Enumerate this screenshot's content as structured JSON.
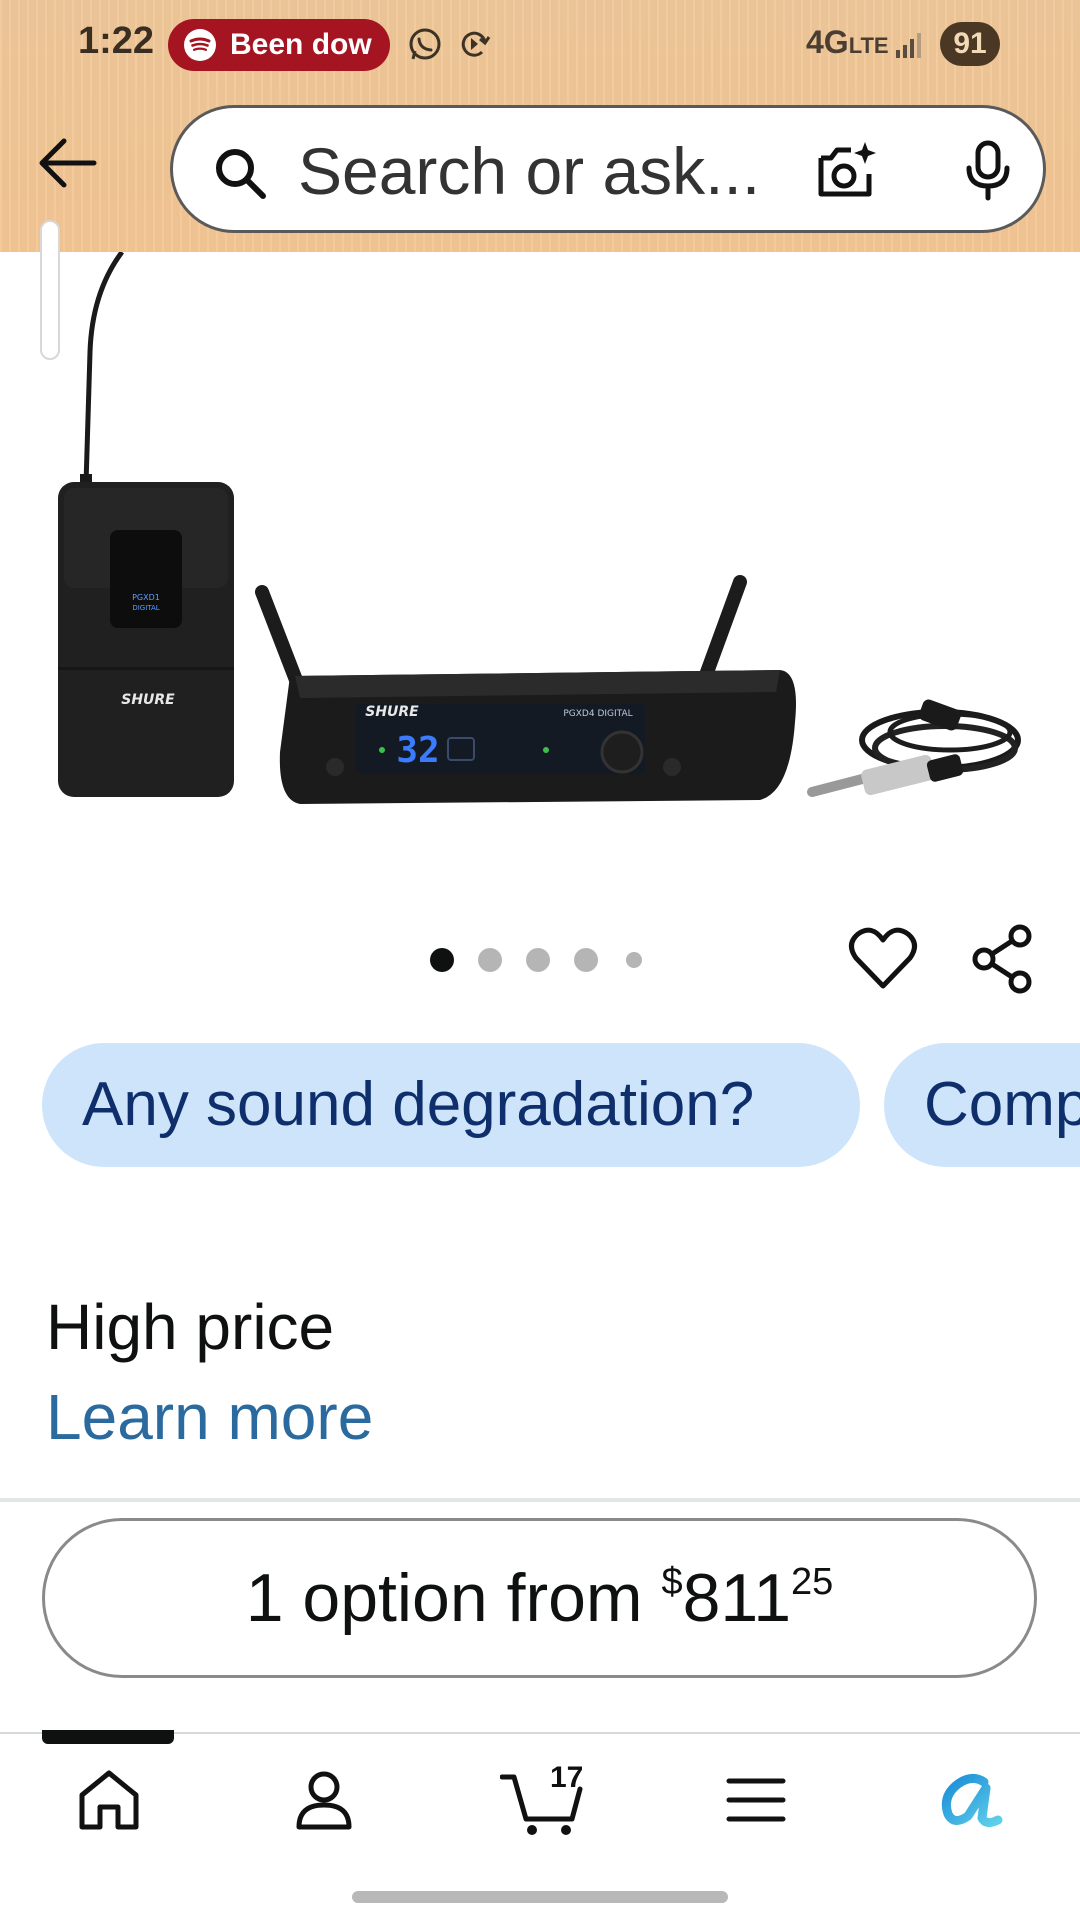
{
  "status_bar": {
    "time": "1:22",
    "notification_text": "Been dow",
    "network": "4G",
    "network_sub": "LTE",
    "battery": "91"
  },
  "search": {
    "placeholder": "Search or ask..."
  },
  "product": {
    "image_alt": "Shure PGXD14 digital wireless guitar system",
    "brand_on_image": "SHURE",
    "model_on_image": "PGXD4 DIGITAL",
    "display_on_image": "32"
  },
  "carousel": {
    "image_count": 5,
    "active_index": 0
  },
  "chips": [
    {
      "label": "Any sound degradation?"
    },
    {
      "label": "Compatible with..."
    }
  ],
  "price_info": {
    "label": "High price",
    "link": "Learn more"
  },
  "options": {
    "prefix": "1 option from ",
    "currency": "$",
    "whole": "811",
    "fraction": "25"
  },
  "nav": {
    "cart_count": "17",
    "items": [
      "home",
      "account",
      "cart",
      "menu",
      "rufus"
    ]
  },
  "colors": {
    "header": "#f4c794",
    "chip_bg": "#cde4fb",
    "chip_text": "#0e2f6b",
    "link": "#2a6a9e",
    "notification": "#a41521",
    "rufus": "#1a8cd8"
  }
}
